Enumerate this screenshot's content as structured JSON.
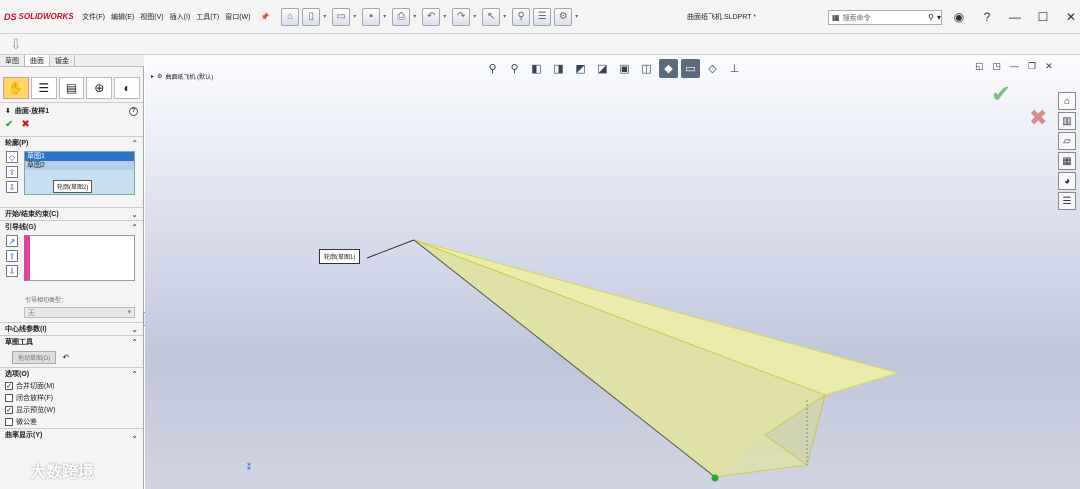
{
  "app": {
    "logo_text": "SOLIDWORKS",
    "logo_mark": "DS"
  },
  "menu": [
    "文件(F)",
    "编辑(E)",
    "视图(V)",
    "插入(I)",
    "工具(T)",
    "窗口(W)"
  ],
  "document_title": "曲面纸飞机.SLDPRT *",
  "search": {
    "placeholder": "搜索命令"
  },
  "tabs": [
    "草图",
    "曲面",
    "钣金"
  ],
  "feature": {
    "title": "曲面-放样1",
    "help": "?"
  },
  "sections": {
    "profiles": "轮廓(P)",
    "start_end": "开始/结束约束(C)",
    "guides": "引导线(G)",
    "centerline": "中心线参数(I)",
    "sketch_tools": "草图工具",
    "options": "选项(O)",
    "preview": "曲率显示(Y)"
  },
  "profiles_list": [
    "草图1",
    "草图2"
  ],
  "profiles_tooltip": "轮廓(草图2)",
  "guide_tangency_label": "引导相切类型：",
  "guide_tangency_value": "无",
  "drag_sketch_button": "拖动草图(D)",
  "options": [
    {
      "label": "合并切面(M)",
      "checked": true
    },
    {
      "label": "闭合放样(F)",
      "checked": false
    },
    {
      "label": "显示预览(W)",
      "checked": true
    },
    {
      "label": "微公差",
      "checked": false
    }
  ],
  "viewport": {
    "tree_label": "曲面纸飞机 (默认)",
    "callout": "轮廓(草图1)"
  },
  "watermark": "大数跨境",
  "colors": {
    "accent": "#2f73c8",
    "surface": "#f2f0a8",
    "guide_stripe": "#e040a0"
  }
}
